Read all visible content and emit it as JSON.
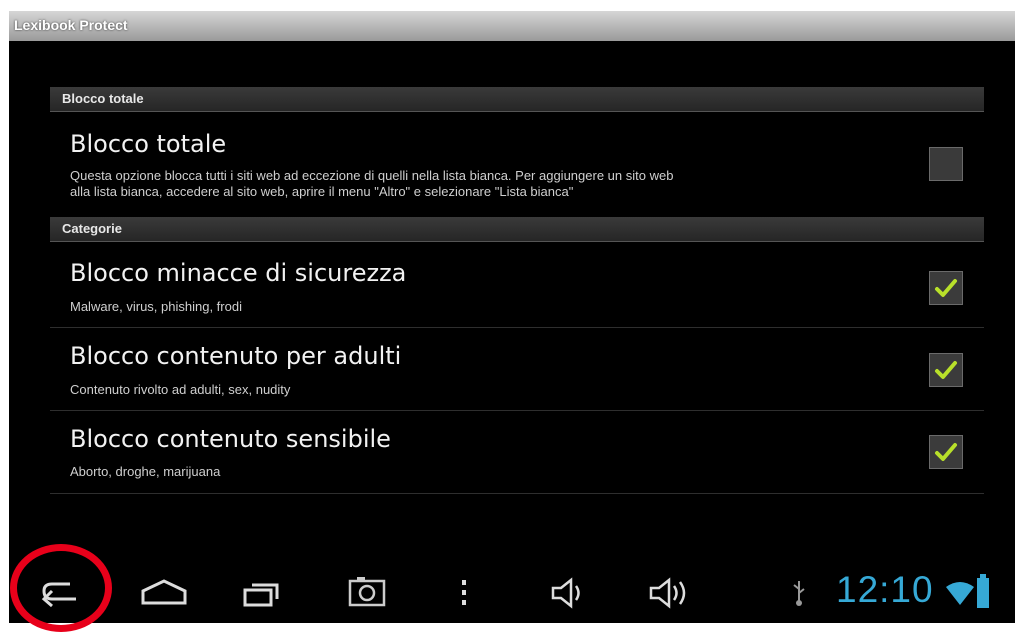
{
  "app": {
    "title": "Lexibook Protect"
  },
  "sections": {
    "total": {
      "header": "Blocco totale"
    },
    "categories": {
      "header": "Categorie"
    }
  },
  "items": {
    "total_block": {
      "title": "Blocco totale",
      "summary_line1": "Questa opzione blocca tutti i siti web ad eccezione di quelli nella lista bianca. Per aggiungere un sito web",
      "summary_line2": "alla lista bianca, accedere al sito web, aprire il menu \"Altro\" e selezionare \"Lista bianca\"",
      "checked": false
    },
    "security": {
      "title": "Blocco minacce di sicurezza",
      "summary": "Malware, virus, phishing, frodi",
      "checked": true
    },
    "adult": {
      "title": "Blocco contenuto per adulti",
      "summary": "Contenuto rivolto ad adulti, sex, nudity",
      "checked": true
    },
    "sensitive": {
      "title": "Blocco contenuto sensibile",
      "summary": "Aborto, droghe, marijuana",
      "checked": true
    }
  },
  "status_bar": {
    "time": "12:10",
    "icons": [
      "usb-icon",
      "wifi-icon",
      "battery-icon"
    ]
  },
  "nav_icons": [
    "back-icon",
    "home-icon",
    "recent-apps-icon",
    "screenshot-icon",
    "menu-icon",
    "volume-down-icon",
    "volume-up-icon"
  ],
  "colors": {
    "accent": "#36a9d6",
    "check": "#b8e02a",
    "highlight_circle": "#e8001a"
  }
}
